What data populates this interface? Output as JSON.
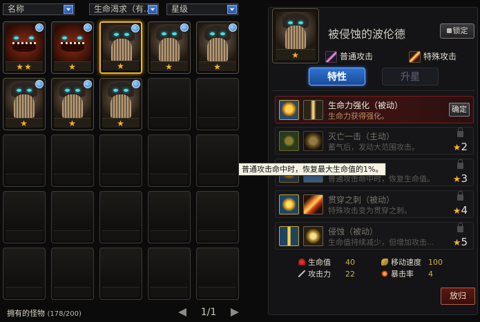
{
  "filters": {
    "name": "名称",
    "hp_demand": "生命渴求（有...",
    "star_level": "星级"
  },
  "grid": {
    "slots": [
      {
        "kind": "red",
        "stars": "★★",
        "badge": true
      },
      {
        "kind": "red",
        "stars": "★",
        "badge": true
      },
      {
        "kind": "brown",
        "stars": "★",
        "badge": true,
        "selected": true
      },
      {
        "kind": "brown",
        "stars": "★",
        "badge": true
      },
      {
        "kind": "brown",
        "stars": "★",
        "badge": true
      },
      {
        "kind": "brown",
        "stars": "★",
        "badge": true
      },
      {
        "kind": "brown",
        "stars": "★",
        "badge": true
      },
      {
        "kind": "brown",
        "stars": "★",
        "badge": true
      }
    ],
    "total_slots": 25
  },
  "footer": {
    "owned_label": "拥有的怪物",
    "owned_count": "(178/200)",
    "page": "1/1"
  },
  "detail": {
    "portrait_stars": "★",
    "name": "被侵蚀的波伦德",
    "lock_label": "锁定",
    "normal_attack": "普通攻击",
    "special_attack": "特殊攻击",
    "tabs": {
      "traits": "特性",
      "upgrade": "升星"
    },
    "skills": [
      {
        "name": "生命力强化（被动）",
        "desc": "生命力获得强化。",
        "action": "确定"
      },
      {
        "name": "灭亡一击（主动）",
        "desc": "蓄气后，发动大范围攻击。",
        "level": "2"
      },
      {
        "name": "",
        "desc": "普通攻击命中时，恢复生命值。",
        "level": "3"
      },
      {
        "name": "贯穿之刺（被动）",
        "desc": "特殊攻击变为贯穿之刺。",
        "level": "4"
      },
      {
        "name": "侵蚀（被动）",
        "desc": "生命值持续减少，但增加攻击...",
        "level": "5"
      }
    ],
    "tooltip": "普通攻击命中时，恢复最大生命值的1%。",
    "stats": {
      "hp_label": "生命值",
      "hp": "40",
      "move_label": "移动速度",
      "move": "100",
      "atk_label": "攻击力",
      "atk": "22",
      "crit_label": "暴击率",
      "crit": "4"
    },
    "return_label": "放归"
  }
}
